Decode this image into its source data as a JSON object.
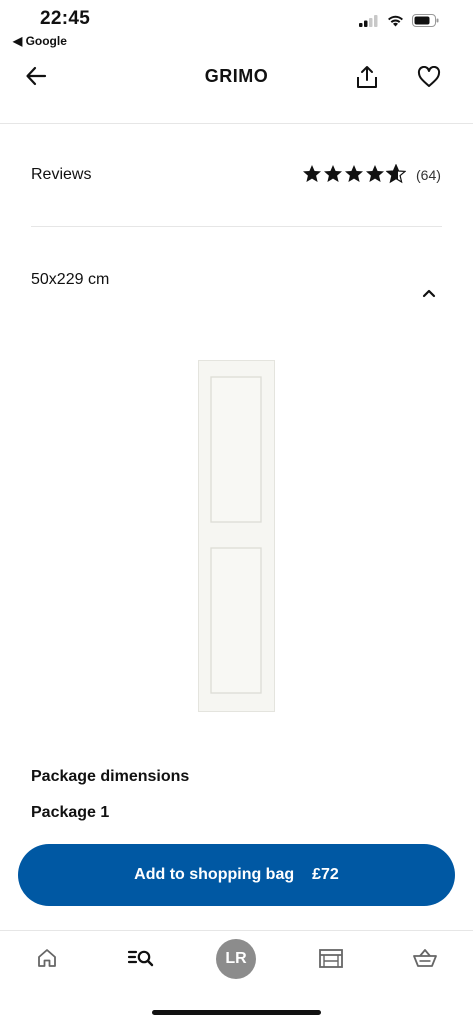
{
  "status_bar": {
    "time": "22:45",
    "back_app": "◀ Google"
  },
  "header": {
    "title": "GRIMO"
  },
  "reviews": {
    "label": "Reviews",
    "rating": 4.6,
    "count": "(64)"
  },
  "variant": {
    "size_label": "50x229 cm"
  },
  "package": {
    "title": "Package dimensions",
    "item": "Package 1"
  },
  "cta": {
    "label": "Add to shopping bag",
    "price": "£72"
  },
  "tabbar": {
    "avatar_initials": "LR"
  },
  "colors": {
    "accent": "#0058a3",
    "avatar": "#8c8c8c",
    "divider": "#e6e6e6"
  }
}
